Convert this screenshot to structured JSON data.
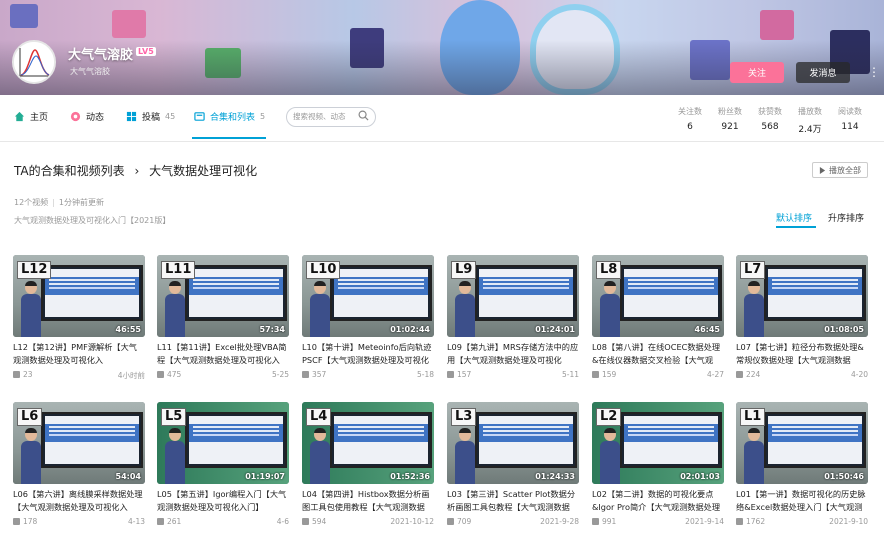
{
  "header": {
    "username": "大气气溶胶",
    "level": "LV5",
    "sign": "大气气溶胶",
    "follow_label": "关注",
    "message_label": "发消息",
    "more_icon": "more-vertical-icon"
  },
  "nav": {
    "home": "主页",
    "dynamic": "动态",
    "posts": "投稿",
    "posts_count": "45",
    "collections": "合集和列表",
    "collections_count": "5",
    "search_placeholder": "搜索视频、动态"
  },
  "stats": [
    {
      "label": "关注数",
      "value": "6"
    },
    {
      "label": "粉丝数",
      "value": "921"
    },
    {
      "label": "获赞数",
      "value": "568"
    },
    {
      "label": "播放数",
      "value": "2.4万"
    },
    {
      "label": "阅读数",
      "value": "114"
    }
  ],
  "content": {
    "breadcrumb_root": "TA的合集和视频列表",
    "breadcrumb_sep": "›",
    "breadcrumb_current": "大气数据处理可视化",
    "play_all": "播放全部",
    "video_count": "12个视频",
    "updated": "1分钟前更新",
    "description": "大气观测数据处理及可视化入门【2021版】",
    "sort_default": "默认排序",
    "sort_asc": "升序排序"
  },
  "videos": [
    {
      "num": "L12",
      "duration": "46:55",
      "title": "L12【第12讲】PMF源解析【大气观测数据处理及可视化入",
      "plays": "23",
      "date": "4小时前",
      "bg": "wall"
    },
    {
      "num": "L11",
      "duration": "57:34",
      "title": "L11【第11讲】Excel批处理VBA简程【大气观测数据处理及可视化入",
      "plays": "475",
      "date": "5-25",
      "bg": "wall"
    },
    {
      "num": "L10",
      "duration": "01:02:44",
      "title": "L10【第十讲】Meteoinfo后向轨迹PSCF【大气观测数据处理及可视化",
      "plays": "357",
      "date": "5-18",
      "bg": "wall"
    },
    {
      "num": "L9",
      "duration": "01:24:01",
      "title": "L09【第九讲】MRS存储方法中的应用【大气观测数据处理及可视化",
      "plays": "157",
      "date": "5-11",
      "bg": "wall"
    },
    {
      "num": "L8",
      "duration": "46:45",
      "title": "L08【第八讲】在线OCEC数据处理&在线仪器数据交叉检验【大气观",
      "plays": "159",
      "date": "4-27",
      "bg": "wall"
    },
    {
      "num": "L7",
      "duration": "01:08:05",
      "title": "L07【第七讲】粒径分布数据处理&常规仪数据处理【大气观测数据",
      "plays": "224",
      "date": "4-20",
      "bg": "wall"
    },
    {
      "num": "L6",
      "duration": "54:04",
      "title": "L06【第六讲】离线膜采样数据处理【大气观测数据处理及可视化入",
      "plays": "178",
      "date": "4-13",
      "bg": "wall"
    },
    {
      "num": "L5",
      "duration": "01:19:07",
      "title": "L05【第五讲】Igor编程入门【大气观测数据处理及可视化入门】",
      "plays": "261",
      "date": "4-6",
      "bg": "green"
    },
    {
      "num": "L4",
      "duration": "01:52:36",
      "title": "L04【第四讲】Histbox数据分析画图工具包使用教程【大气观测数据",
      "plays": "594",
      "date": "2021-10-12",
      "bg": "green"
    },
    {
      "num": "L3",
      "duration": "01:24:33",
      "title": "L03【第三讲】Scatter Plot数据分析画图工具包教程【大气观测数据",
      "plays": "709",
      "date": "2021-9-28",
      "bg": "wall"
    },
    {
      "num": "L2",
      "duration": "02:01:03",
      "title": "L02【第二讲】数据的可视化要点&Igor Pro简介【大气观测数据处理",
      "plays": "991",
      "date": "2021-9-14",
      "bg": "green"
    },
    {
      "num": "L1",
      "duration": "01:50:46",
      "title": "L01【第一讲】数据可视化的历史脉络&Excel数据处理入门【大气观测",
      "plays": "1762",
      "date": "2021-9-10",
      "bg": "wall"
    }
  ],
  "colors": {
    "accent": "#00a1d6",
    "follow": "#fb7299"
  }
}
